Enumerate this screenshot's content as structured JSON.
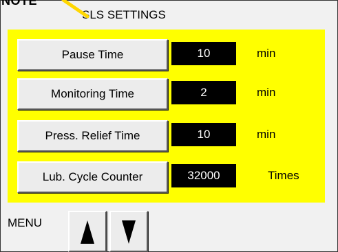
{
  "callout_label": "NOTE",
  "screen_title": "SLS SETTINGS",
  "settings": [
    {
      "label": "Pause Time",
      "value": "10",
      "unit": "min"
    },
    {
      "label": "Monitoring Time",
      "value": "2",
      "unit": "min"
    },
    {
      "label": "Press. Relief Time",
      "value": "10",
      "unit": "min"
    },
    {
      "label": "Lub. Cycle Counter",
      "value": "32000",
      "unit": "Times"
    }
  ],
  "bottom": {
    "menu_label": "MENU",
    "up_icon": "up-arrow-icon",
    "down_icon": "down-arrow-icon"
  },
  "colors": {
    "highlight": "#ffff00",
    "value_bg": "#000000",
    "value_text": "#ffffff",
    "callout": "#ffd700"
  }
}
